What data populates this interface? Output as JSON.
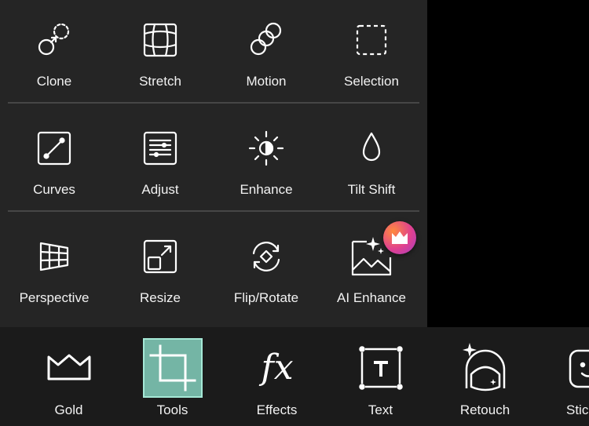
{
  "tools": {
    "rows": [
      [
        {
          "label": "Clone",
          "icon": "clone-icon"
        },
        {
          "label": "Stretch",
          "icon": "stretch-icon"
        },
        {
          "label": "Motion",
          "icon": "motion-icon"
        },
        {
          "label": "Selection",
          "icon": "selection-icon"
        }
      ],
      [
        {
          "label": "Curves",
          "icon": "curves-icon"
        },
        {
          "label": "Adjust",
          "icon": "adjust-icon"
        },
        {
          "label": "Enhance",
          "icon": "enhance-icon"
        },
        {
          "label": "Tilt Shift",
          "icon": "tilt-shift-icon"
        }
      ],
      [
        {
          "label": "Perspective",
          "icon": "perspective-icon"
        },
        {
          "label": "Resize",
          "icon": "resize-icon"
        },
        {
          "label": "Flip/Rotate",
          "icon": "flip-rotate-icon"
        },
        {
          "label": "AI Enhance",
          "icon": "ai-enhance-icon"
        }
      ]
    ],
    "premium_badge_icon": "crown-icon"
  },
  "bottom_nav": {
    "items": [
      {
        "label": "Gold",
        "icon": "crown-icon"
      },
      {
        "label": "Tools",
        "icon": "crop-icon",
        "active": true
      },
      {
        "label": "Effects",
        "icon": "fx-icon"
      },
      {
        "label": "Text",
        "icon": "text-icon"
      },
      {
        "label": "Retouch",
        "icon": "retouch-icon"
      },
      {
        "label": "Stic",
        "icon": "sticker-icon"
      }
    ]
  },
  "colors": {
    "panel_bg": "#252525",
    "bottom_bg": "#1b1b1b",
    "active_tab": "#74b5a5",
    "badge_gradient": [
      "#ff8a3d",
      "#e0418f",
      "#a43cc4"
    ]
  }
}
